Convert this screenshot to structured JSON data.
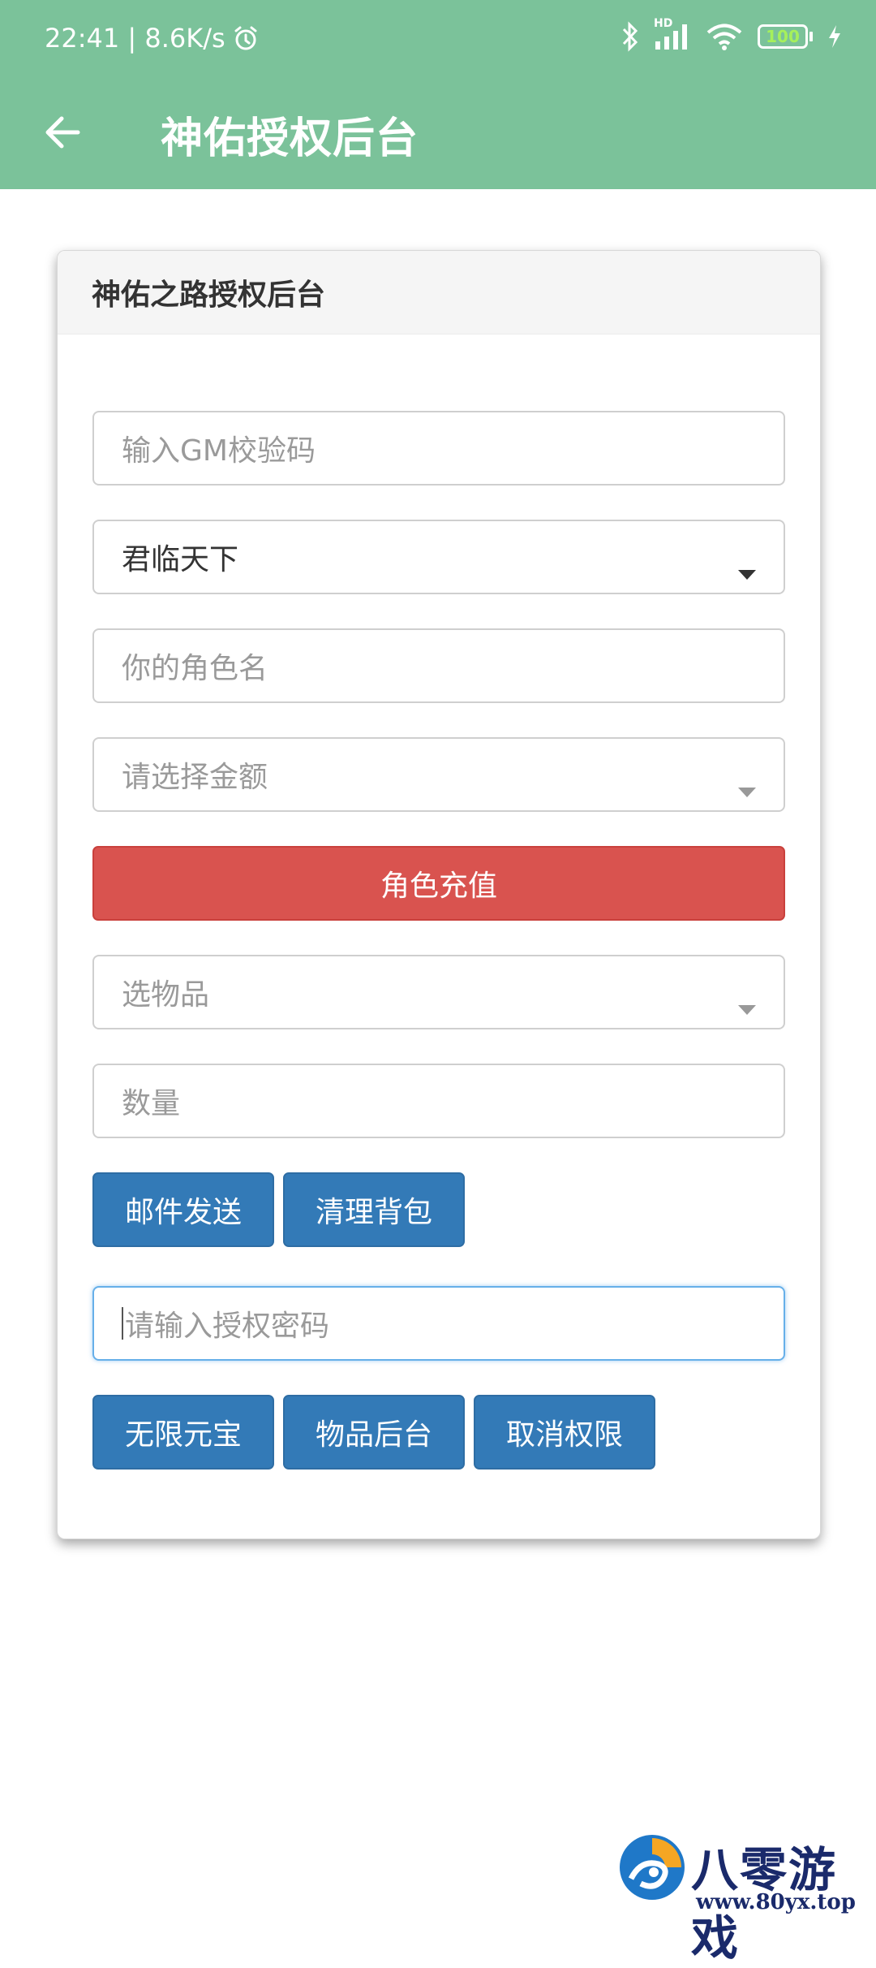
{
  "status_bar": {
    "time_speed": "22:41 | 8.6K/s",
    "battery": "100",
    "network_badge": "HD"
  },
  "app_bar": {
    "title": "神佑授权后台"
  },
  "card": {
    "header": "神佑之路授权后台",
    "gm_code": {
      "placeholder": "输入GM校验码"
    },
    "server_select": {
      "value": "君临天下"
    },
    "role_name": {
      "placeholder": "你的角色名"
    },
    "amount_select": {
      "placeholder": "请选择金额"
    },
    "recharge_button": "角色充值",
    "item_select": {
      "placeholder": "选物品"
    },
    "quantity": {
      "placeholder": "数量"
    },
    "mail_send_button": "邮件发送",
    "clear_bag_button": "清理背包",
    "auth_password": {
      "placeholder": "请输入授权密码"
    },
    "unlimited_gold_button": "无限元宝",
    "item_backend_button": "物品后台",
    "revoke_button": "取消权限"
  },
  "watermark": {
    "name": "八零游戏",
    "url": "www.80yx.top"
  },
  "colors": {
    "app_bar": "#7bc29a",
    "danger": "#d9534f",
    "primary": "#337ab7"
  }
}
